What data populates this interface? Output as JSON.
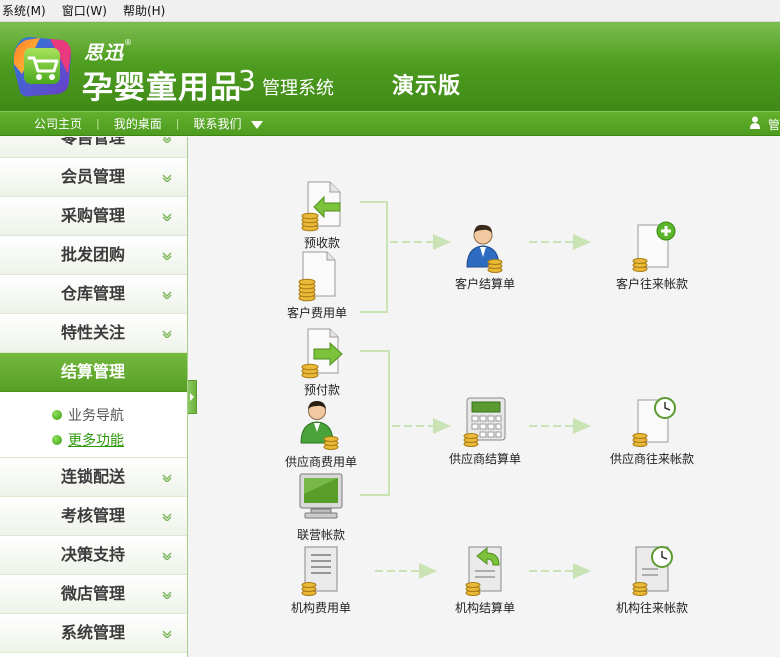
{
  "menubar": {
    "items": [
      "系统(M)",
      "窗口(W)",
      "帮助(H)"
    ]
  },
  "header": {
    "brand_small": "思迅",
    "brand_reg": "®",
    "product": "孕婴童用品",
    "version": "3",
    "system": "管理系统",
    "edition": "演示版"
  },
  "nav": {
    "links": [
      "公司主页",
      "我的桌面",
      "联系我们"
    ],
    "user_label": "管"
  },
  "sidebar": {
    "items": [
      {
        "label": "零售管理"
      },
      {
        "label": "会员管理"
      },
      {
        "label": "采购管理"
      },
      {
        "label": "批发团购"
      },
      {
        "label": "仓库管理"
      },
      {
        "label": "特性关注"
      },
      {
        "label": "结算管理",
        "active": true
      },
      {
        "label": "连锁配送"
      },
      {
        "label": "考核管理"
      },
      {
        "label": "决策支持"
      },
      {
        "label": "微店管理"
      },
      {
        "label": "系统管理"
      }
    ],
    "sub_items": [
      {
        "label": "业务导航"
      },
      {
        "label": "更多功能",
        "current": true
      }
    ]
  },
  "flow": {
    "nodes": {
      "advance_receipt": "预收款",
      "customer_expense": "客户费用单",
      "customer_settlement": "客户结算单",
      "customer_account": "客户往来帐款",
      "advance_payment": "预付款",
      "supplier_expense": "供应商费用单",
      "supplier_settlement": "供应商结算单",
      "supplier_account": "供应商往来帐款",
      "joint_account": "联营帐款",
      "org_expense": "机构费用单",
      "org_settlement": "机构结算单",
      "org_account": "机构往来帐款"
    }
  },
  "colors": {
    "brand_green": "#4c9a1f",
    "active_green": "#579f26",
    "link_green": "#2f9a0d",
    "connector": "#c9e3b5"
  }
}
